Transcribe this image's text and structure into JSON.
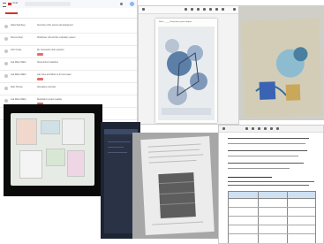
{
  "collage": {
    "email_window": {
      "app_name": "Gmail",
      "rows": [
        {
          "sender": "Adam Weinberg",
          "subject": "Summary of the science lab assignment"
        },
        {
          "sender": "Science Dept.",
          "subject": "Worksheet: wrk and the respiratory system"
        },
        {
          "sender": "John Cooke",
          "subject": "Re: homework rubric question"
        },
        {
          "sender": "Lisa Marie Walsh",
          "subject": "Class photo & attached"
        },
        {
          "sender": "Lisa Marie Walsh",
          "subject": "Lab notes and follow up for next week"
        },
        {
          "sender": "Dale Thomas",
          "subject": "Attendance reminder"
        },
        {
          "sender": "Lisa Marie Walsh",
          "subject": "Respiratory system reading"
        },
        {
          "sender": "Teacher Team",
          "subject": "Planning for the upcoming unit"
        }
      ]
    },
    "worksheet_viewer": {
      "title": "Name: _____ Respiratory system diagram"
    },
    "table_document": {
      "headers": [
        "",
        "",
        ""
      ]
    }
  }
}
